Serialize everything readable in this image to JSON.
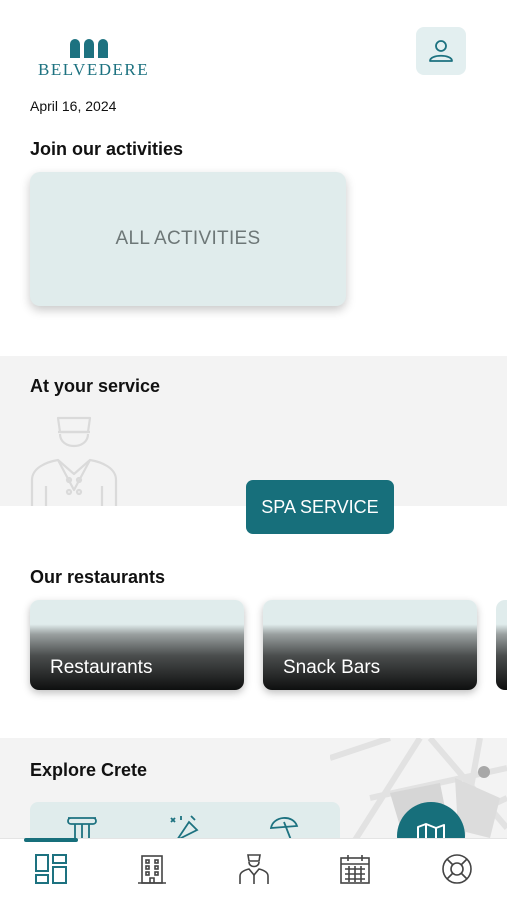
{
  "header": {
    "logo_text": "BELVEDERE",
    "date": "April 16, 2024",
    "profile_icon": "user-icon"
  },
  "activities": {
    "title": "Join our activities",
    "card_label": "ALL ACTIVITIES"
  },
  "service": {
    "title": "At your service",
    "icon": "bellboy-icon",
    "spa_button": "SPA SERVICE"
  },
  "restaurants": {
    "title": "Our restaurants",
    "cards": [
      {
        "label": "Restaurants"
      },
      {
        "label": "Snack Bars"
      }
    ]
  },
  "explore": {
    "title": "Explore Crete",
    "icons": [
      "column-icon",
      "party-icon",
      "beach-umbrella-icon"
    ],
    "fab_icon": "map-icon"
  },
  "bottom_nav": {
    "items": [
      "dashboard-icon",
      "hotel-icon",
      "concierge-icon",
      "calendar-icon",
      "lifebuoy-icon"
    ],
    "active_index": 0
  },
  "colors": {
    "accent": "#176f7b",
    "card_bg": "#e0ecec",
    "band_bg": "#f3f3f3"
  }
}
